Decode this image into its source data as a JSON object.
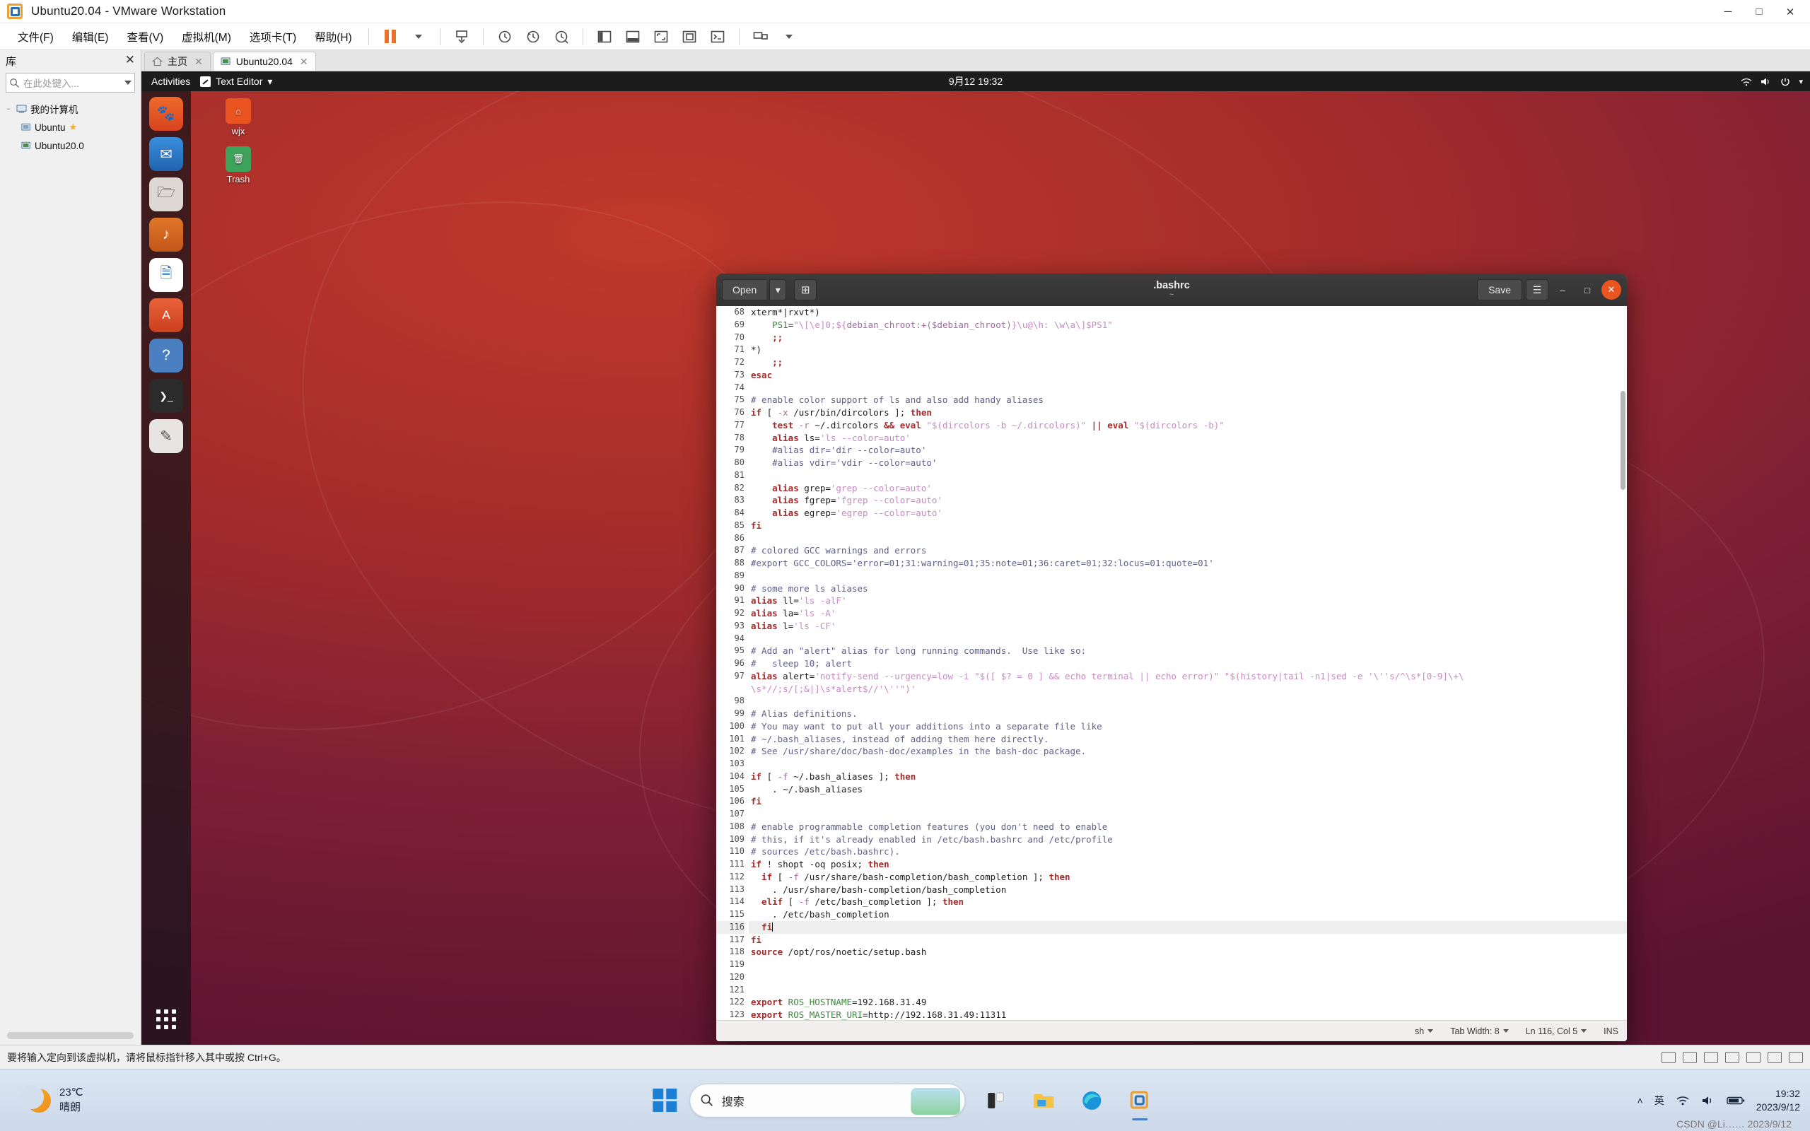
{
  "vmware": {
    "title": "Ubuntu20.04  - VMware Workstation",
    "window_controls": {
      "minimize": "─",
      "maximize": "□",
      "close": "✕"
    },
    "menus": [
      {
        "label": "文件(F)"
      },
      {
        "label": "编辑(E)"
      },
      {
        "label": "查看(V)"
      },
      {
        "label": "虚拟机(M)"
      },
      {
        "label": "选项卡(T)"
      },
      {
        "label": "帮助(H)"
      }
    ],
    "toolbar_icons": [
      "pause-icon",
      "dropdown-caret-icon",
      "power-snapshot-icon",
      "snapshot-clock-icon",
      "revert-snapshot-icon",
      "snapshot-manager-icon",
      "show-left-pane-icon",
      "show-bottom-pane-icon",
      "fullscreen-icon",
      "unity-mode-icon",
      "console-icon",
      "multi-monitor-icon",
      "settings-caret-icon"
    ],
    "sidebar": {
      "title": "库",
      "close_label": "✕",
      "search_placeholder": "在此处键入...",
      "search_icon": "search-icon",
      "tree": [
        {
          "label": "我的计算机",
          "level": 1,
          "icon": "computer-icon",
          "twisty": "−",
          "starred": false
        },
        {
          "label": "Ubuntu",
          "level": 2,
          "icon": "vm-icon",
          "twisty": "",
          "starred": true
        },
        {
          "label": "Ubuntu20.0",
          "level": 2,
          "icon": "vm-icon",
          "twisty": "",
          "starred": false
        }
      ]
    },
    "tabs": [
      {
        "label": "主页",
        "icon": "home-icon",
        "active": false,
        "close": "✕"
      },
      {
        "label": "Ubuntu20.04",
        "icon": "vm-icon",
        "active": true,
        "close": "✕"
      }
    ],
    "status_text": "要将输入定向到该虚拟机，请将鼠标指针移入其中或按 Ctrl+G。",
    "status_icons": [
      "hdd-icon",
      "cd-icon",
      "network-icon",
      "usb-icon",
      "sound-icon",
      "printer-icon",
      "display-icon"
    ]
  },
  "ubuntu": {
    "topbar": {
      "activities": "Activities",
      "app_name": "Text Editor",
      "app_caret": "▾",
      "clock": "9月12 19:32",
      "right_icons": [
        "network-icon",
        "volume-icon",
        "power-icon",
        "caret-down-icon"
      ]
    },
    "dock": [
      {
        "name": "firefox-icon",
        "glyph": "🦊",
        "color": "#e55b2b"
      },
      {
        "name": "thunderbird-icon",
        "glyph": "✉",
        "color": "#2a7fd4"
      },
      {
        "name": "files-icon",
        "glyph": "🗀",
        "color": "#d8d4d0"
      },
      {
        "name": "rhythmbox-icon",
        "glyph": "♫",
        "color": "#d86a20"
      },
      {
        "name": "libreoffice-writer-icon",
        "glyph": "🗎",
        "color": "#2a6fb5"
      },
      {
        "name": "ubuntu-software-icon",
        "glyph": "Ａ",
        "color": "#e0552c"
      },
      {
        "name": "help-icon",
        "glyph": "?",
        "color": "#4a7fc1"
      },
      {
        "name": "terminal-icon",
        "glyph": "❯_",
        "color": "#2b2b2b"
      },
      {
        "name": "text-editor-icon",
        "glyph": "✎",
        "color": "#5a5a8a"
      }
    ],
    "dock_show_apps": "show-applications-icon",
    "desktop_icons": [
      {
        "label": "wjx",
        "icon": "home-folder-icon",
        "color": "#e95420"
      },
      {
        "label": "Trash",
        "icon": "trash-icon",
        "color": "#3ea35a"
      }
    ]
  },
  "gedit": {
    "open_label": "Open",
    "open_caret": "▾",
    "new_tab_icon": "new-tab-icon",
    "title": ".bashrc",
    "subtitle": "~",
    "save_label": "Save",
    "menu_icon": "hamburger-menu-icon",
    "minimize": "–",
    "maximize": "□",
    "close": "✕",
    "statusbar": {
      "language": "sh",
      "language_caret": "▾",
      "tab_width": "Tab Width: 8",
      "tab_caret": "▾",
      "position": "Ln 116, Col 5",
      "position_caret": "▾",
      "insert_mode": "INS"
    },
    "first_line_number": 68,
    "current_line": 116,
    "lines": [
      [
        [
          "n",
          "xterm*|rxvt*)"
        ]
      ],
      [
        [
          "n",
          "    "
        ],
        [
          "v",
          "PS1"
        ],
        [
          "n",
          "="
        ],
        [
          "s",
          "\"\\[\\e]0;${"
        ],
        [
          "s2",
          "debian_chroot:+($debian_chroot)"
        ],
        [
          "s",
          "}\\u@\\h: \\w\\a\\]$PS1\""
        ]
      ],
      [
        [
          "op",
          "    ;;"
        ]
      ],
      [
        [
          "n",
          "*)"
        ]
      ],
      [
        [
          "op",
          "    ;;"
        ]
      ],
      [
        [
          "k",
          "esac"
        ]
      ],
      [
        [
          "n",
          ""
        ]
      ],
      [
        [
          "cm",
          "# enable color support of ls and also add handy aliases"
        ]
      ],
      [
        [
          "k",
          "if"
        ],
        [
          "n",
          " ["
        ],
        [
          "s2",
          " -x"
        ],
        [
          "n",
          " /usr/bin/dircolors ];"
        ],
        [
          "k",
          " then"
        ]
      ],
      [
        [
          "k",
          "    test"
        ],
        [
          "s2",
          " -r"
        ],
        [
          "n",
          " ~/.dircolors "
        ],
        [
          "op",
          "&&"
        ],
        [
          "k",
          " eval"
        ],
        [
          "s",
          " \"$(dircolors -b ~/.dircolors)\""
        ],
        [
          "op",
          " ||"
        ],
        [
          "k",
          " eval"
        ],
        [
          "s",
          " \"$(dircolors -b)\""
        ]
      ],
      [
        [
          "k",
          "    alias"
        ],
        [
          "n",
          " ls="
        ],
        [
          "s",
          "'ls --color=auto'"
        ]
      ],
      [
        [
          "cm",
          "    #alias dir='dir --color=auto'"
        ]
      ],
      [
        [
          "cm",
          "    #alias vdir='vdir --color=auto'"
        ]
      ],
      [
        [
          "n",
          ""
        ]
      ],
      [
        [
          "k",
          "    alias"
        ],
        [
          "n",
          " grep="
        ],
        [
          "s",
          "'grep --color=auto'"
        ]
      ],
      [
        [
          "k",
          "    alias"
        ],
        [
          "n",
          " fgrep="
        ],
        [
          "s",
          "'fgrep --color=auto'"
        ]
      ],
      [
        [
          "k",
          "    alias"
        ],
        [
          "n",
          " egrep="
        ],
        [
          "s",
          "'egrep --color=auto'"
        ]
      ],
      [
        [
          "k",
          "fi"
        ]
      ],
      [
        [
          "n",
          ""
        ]
      ],
      [
        [
          "cm",
          "# colored GCC warnings and errors"
        ]
      ],
      [
        [
          "cm",
          "#export GCC_COLORS='error=01;31:warning=01;35:note=01;36:caret=01;32:locus=01:quote=01'"
        ]
      ],
      [
        [
          "n",
          ""
        ]
      ],
      [
        [
          "cm",
          "# some more ls aliases"
        ]
      ],
      [
        [
          "k",
          "alias"
        ],
        [
          "n",
          " ll="
        ],
        [
          "s",
          "'ls -alF'"
        ]
      ],
      [
        [
          "k",
          "alias"
        ],
        [
          "n",
          " la="
        ],
        [
          "s",
          "'ls -A'"
        ]
      ],
      [
        [
          "k",
          "alias"
        ],
        [
          "n",
          " l="
        ],
        [
          "s",
          "'ls -CF'"
        ]
      ],
      [
        [
          "n",
          ""
        ]
      ],
      [
        [
          "cm",
          "# Add an \"alert\" alias for long running commands.  Use like so:"
        ]
      ],
      [
        [
          "cm",
          "#   sleep 10; alert"
        ]
      ],
      [
        [
          "k",
          "alias"
        ],
        [
          "n",
          " alert="
        ],
        [
          "s",
          "'notify-send --urgency=low -i \"$([ $? = 0 ] && echo terminal || echo error)\" \"$(history|tail -n1|sed -e '\\''s/^\\s*[0-9]\\+\\"
        ]
      ],
      [
        [
          "s",
          "\\s*//;s/[;&|]\\s*alert$//'\\''\")'"
        ]
      ],
      [
        [
          "n",
          ""
        ]
      ],
      [
        [
          "cm",
          "# Alias definitions."
        ]
      ],
      [
        [
          "cm",
          "# You may want to put all your additions into a separate file like"
        ]
      ],
      [
        [
          "cm",
          "# ~/.bash_aliases, instead of adding them here directly."
        ]
      ],
      [
        [
          "cm",
          "# See /usr/share/doc/bash-doc/examples in the bash-doc package."
        ]
      ],
      [
        [
          "n",
          ""
        ]
      ],
      [
        [
          "k",
          "if"
        ],
        [
          "n",
          " ["
        ],
        [
          "s2",
          " -f"
        ],
        [
          "n",
          " ~/.bash_aliases ];"
        ],
        [
          "k",
          " then"
        ]
      ],
      [
        [
          "n",
          "    . ~/.bash_aliases"
        ]
      ],
      [
        [
          "k",
          "fi"
        ]
      ],
      [
        [
          "n",
          ""
        ]
      ],
      [
        [
          "cm",
          "# enable programmable completion features (you don't need to enable"
        ]
      ],
      [
        [
          "cm",
          "# this, if it's already enabled in /etc/bash.bashrc and /etc/profile"
        ]
      ],
      [
        [
          "cm",
          "# sources /etc/bash.bashrc)."
        ]
      ],
      [
        [
          "k",
          "if"
        ],
        [
          "n",
          " ! shopt -oq posix;"
        ],
        [
          "k",
          " then"
        ]
      ],
      [
        [
          "k",
          "  if"
        ],
        [
          "n",
          " ["
        ],
        [
          "s2",
          " -f"
        ],
        [
          "n",
          " /usr/share/bash-completion/bash_completion ];"
        ],
        [
          "k",
          " then"
        ]
      ],
      [
        [
          "n",
          "    . /usr/share/bash-completion/bash_completion"
        ]
      ],
      [
        [
          "k",
          "  elif"
        ],
        [
          "n",
          " ["
        ],
        [
          "s2",
          " -f"
        ],
        [
          "n",
          " /etc/bash_completion ];"
        ],
        [
          "k",
          " then"
        ]
      ],
      [
        [
          "n",
          "    . /etc/bash_completion"
        ]
      ],
      [
        [
          "k",
          "  fi"
        ]
      ],
      [
        [
          "k",
          "fi"
        ]
      ],
      [
        [
          "k",
          "source"
        ],
        [
          "n",
          " /opt/ros/noetic/setup.bash"
        ]
      ],
      [
        [
          "n",
          ""
        ]
      ],
      [
        [
          "n",
          ""
        ]
      ],
      [
        [
          "n",
          ""
        ]
      ],
      [
        [
          "k",
          "export"
        ],
        [
          "v",
          " ROS_HOSTNAME"
        ],
        [
          "n",
          "=192.168.31.49"
        ]
      ],
      [
        [
          "k",
          "export"
        ],
        [
          "v",
          " ROS_MASTER_URI"
        ],
        [
          "n",
          "=http://192.168.31.49:11311"
        ]
      ]
    ]
  },
  "taskbar": {
    "weather_temp": "23℃",
    "weather_desc": "晴朗",
    "start_icon": "windows-start-icon",
    "search_placeholder": "搜索",
    "search_icon": "search-icon",
    "apps": [
      {
        "name": "widgets-icon",
        "active": false
      },
      {
        "name": "file-explorer-icon",
        "active": false
      },
      {
        "name": "edge-icon",
        "active": false
      },
      {
        "name": "vmware-workstation-icon",
        "active": true
      }
    ],
    "tray": {
      "caret": "˄",
      "ime": "英",
      "wifi_icon": "wifi-icon",
      "volume_icon": "volume-icon",
      "battery_icon": "battery-icon"
    },
    "clock_time": "19:32",
    "clock_date": "2023/9/12",
    "watermark": "CSDN @Li…… 2023/9/12"
  }
}
